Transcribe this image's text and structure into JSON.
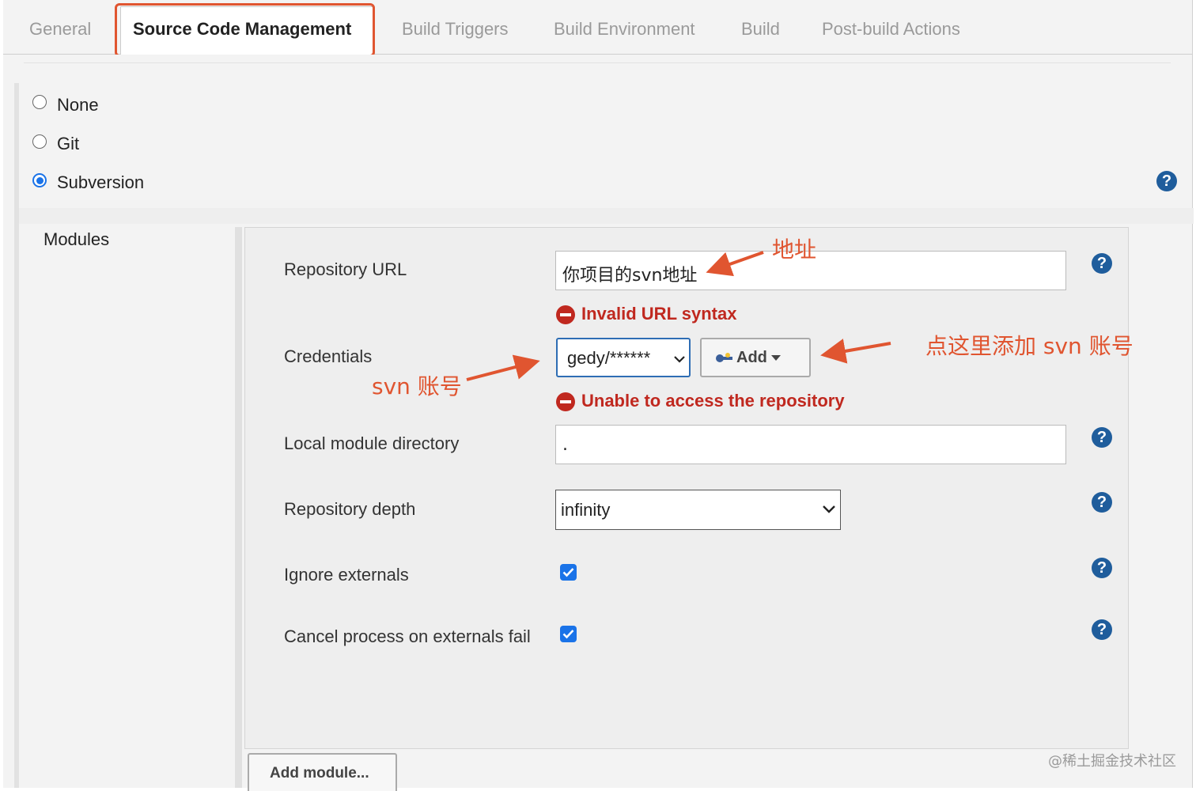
{
  "tabs": [
    "General",
    "Source Code Management",
    "Build Triggers",
    "Build Environment",
    "Build",
    "Post-build Actions"
  ],
  "active_tab": "Source Code Management",
  "scm_options": [
    {
      "label": "None",
      "selected": false
    },
    {
      "label": "Git",
      "selected": false
    },
    {
      "label": "Subversion",
      "selected": true
    }
  ],
  "modules_label": "Modules",
  "fields": {
    "repo_url_label": "Repository URL",
    "repo_url_value": "你项目的svn地址",
    "repo_url_error": "Invalid URL syntax",
    "credentials_label": "Credentials",
    "credentials_value": "gedy/******",
    "add_label": "Add",
    "credentials_error": "Unable to access the repository",
    "local_dir_label": "Local module directory",
    "local_dir_value": ".",
    "depth_label": "Repository depth",
    "depth_value": "infinity",
    "ignore_externals_label": "Ignore externals",
    "ignore_externals_checked": true,
    "cancel_externals_label": "Cancel process on externals fail",
    "cancel_externals_checked": true
  },
  "add_module_label": "Add module...",
  "help_symbol": "?",
  "annotations": {
    "address": "地址",
    "add_account": "点这里添加 svn 账号",
    "svn_account": "svn 账号"
  },
  "watermark": "@稀土掘金技术社区",
  "colors": {
    "accent": "#1a73e8",
    "error": "#c0281f",
    "annotation": "#e05530",
    "help": "#1f5d9c"
  }
}
